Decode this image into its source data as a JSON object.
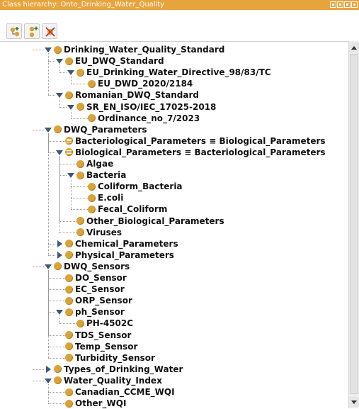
{
  "window": {
    "title": "Class hierarchy: Onto_Drinking_Water_Quality"
  },
  "toolbar": {
    "buttons": [
      {
        "icon": "add-subclass-icon"
      },
      {
        "icon": "add-sibling-class-icon"
      },
      {
        "icon": "delete-class-icon"
      }
    ]
  },
  "colors": {
    "title_bar": "#e8a43c",
    "class_dot": "#d9a339",
    "expander": "#3b5878"
  },
  "tree": {
    "rows": [
      {
        "label": "Drinking_Water_Quality_Standard",
        "depth": 0,
        "state": "open",
        "icon": "class"
      },
      {
        "label": "EU_DWQ_Standard",
        "depth": 1,
        "state": "open",
        "icon": "class"
      },
      {
        "label": "EU_Drinking_Water_Directive_98/83/TC",
        "depth": 2,
        "state": "open",
        "icon": "class"
      },
      {
        "label": "EU_DWD_2020/2184",
        "depth": 3,
        "state": "leaf",
        "icon": "class"
      },
      {
        "label": "Romanian_DWQ_Standard",
        "depth": 1,
        "state": "open",
        "icon": "class"
      },
      {
        "label": "SR_EN_ISO/IEC_17025-2018",
        "depth": 2,
        "state": "open",
        "icon": "class"
      },
      {
        "label": "Ordinance_no_7/2023",
        "depth": 3,
        "state": "leaf",
        "icon": "class"
      },
      {
        "label": "DWQ_Parameters",
        "depth": 0,
        "state": "open",
        "icon": "class"
      },
      {
        "label": "Bacteriological_Parameters ≡ Biological_Parameters",
        "depth": 1,
        "state": "leaf",
        "icon": "equivalent"
      },
      {
        "label": "Biological_Parameters ≡ Bacteriological_Parameters",
        "depth": 1,
        "state": "open",
        "icon": "equivalent"
      },
      {
        "label": "Algae",
        "depth": 2,
        "state": "leaf",
        "icon": "class"
      },
      {
        "label": "Bacteria",
        "depth": 2,
        "state": "open",
        "icon": "class"
      },
      {
        "label": "Coliform_Bacteria",
        "depth": 3,
        "state": "leaf",
        "icon": "class"
      },
      {
        "label": "E.coli",
        "depth": 3,
        "state": "leaf",
        "icon": "class"
      },
      {
        "label": "Fecal_Coliform",
        "depth": 3,
        "state": "leaf",
        "icon": "class"
      },
      {
        "label": "Other_Biological_Parameters",
        "depth": 2,
        "state": "leaf",
        "icon": "class"
      },
      {
        "label": "Viruses",
        "depth": 2,
        "state": "leaf",
        "icon": "class"
      },
      {
        "label": "Chemical_Parameters",
        "depth": 1,
        "state": "closed",
        "icon": "class"
      },
      {
        "label": "Physical_Parameters",
        "depth": 1,
        "state": "closed",
        "icon": "class"
      },
      {
        "label": "DWQ_Sensors",
        "depth": 0,
        "state": "open",
        "icon": "class"
      },
      {
        "label": "DO_Sensor",
        "depth": 1,
        "state": "leaf",
        "icon": "class"
      },
      {
        "label": "EC_Sensor",
        "depth": 1,
        "state": "leaf",
        "icon": "class"
      },
      {
        "label": "ORP_Sensor",
        "depth": 1,
        "state": "leaf",
        "icon": "class"
      },
      {
        "label": "ph_Sensor",
        "depth": 1,
        "state": "open",
        "icon": "class"
      },
      {
        "label": "PH-4502C",
        "depth": 2,
        "state": "leaf",
        "icon": "class"
      },
      {
        "label": "TDS_Sensor",
        "depth": 1,
        "state": "leaf",
        "icon": "class"
      },
      {
        "label": "Temp_Sensor",
        "depth": 1,
        "state": "leaf",
        "icon": "class"
      },
      {
        "label": "Turbidity_Sensor",
        "depth": 1,
        "state": "leaf",
        "icon": "class"
      },
      {
        "label": "Types_of_Drinking_Water",
        "depth": 0,
        "state": "closed",
        "icon": "class"
      },
      {
        "label": "Water_Quality_Index",
        "depth": 0,
        "state": "open",
        "icon": "class"
      },
      {
        "label": "Canadian_CCME_WQI",
        "depth": 1,
        "state": "leaf",
        "icon": "class"
      },
      {
        "label": "Other_WQI",
        "depth": 1,
        "state": "leaf",
        "icon": "class"
      }
    ]
  }
}
